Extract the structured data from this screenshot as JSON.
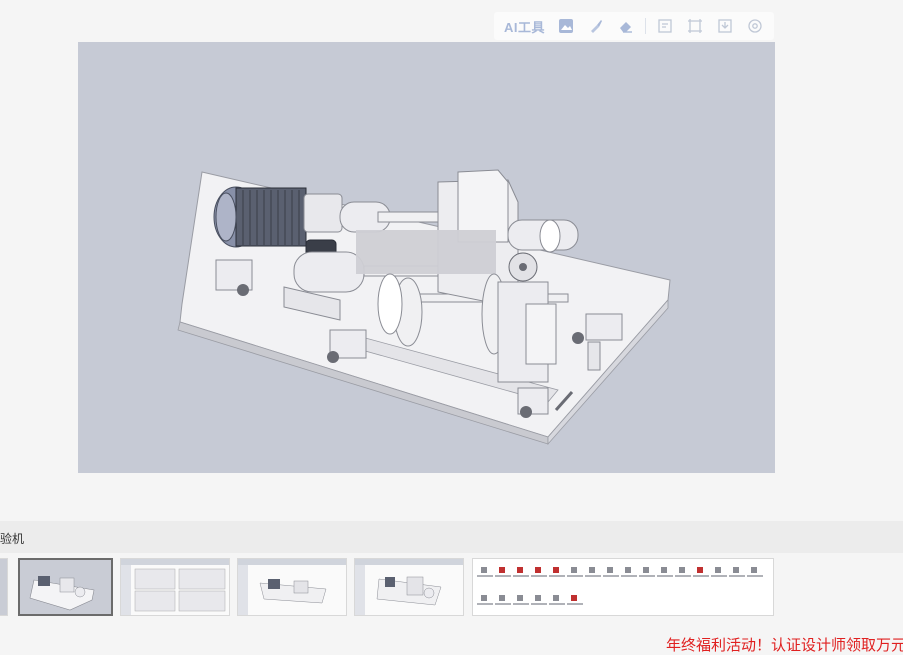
{
  "toolbar": {
    "ai_label": "AI工具",
    "icons": [
      "image-icon",
      "brush-icon",
      "eraser-icon",
      "crop-icon",
      "resize-icon",
      "download-icon",
      "settings-icon"
    ],
    "accent_color": "#a8b8d8"
  },
  "viewer": {
    "background_color": "#c6cad5"
  },
  "caption": {
    "text": "试验机"
  },
  "thumbnails": {
    "count": 6,
    "selected_index": 1
  },
  "promo": {
    "text": "年终福利活动！认证设计师领取万元现金",
    "color": "#e02020"
  }
}
